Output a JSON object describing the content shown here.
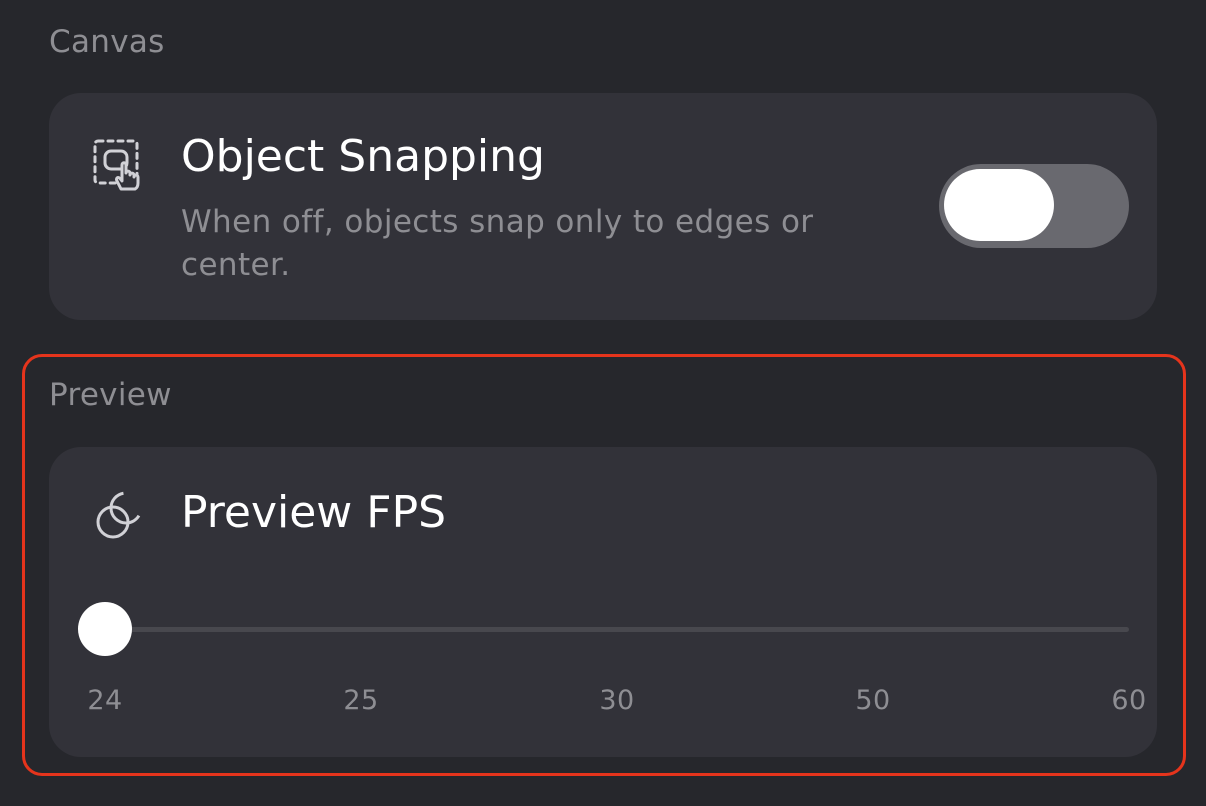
{
  "canvas_section": {
    "label": "Canvas",
    "object_snapping": {
      "icon": "object-snapping-icon",
      "title": "Object Snapping",
      "description": "When off, objects snap only to edges or center.",
      "toggle_on": false
    }
  },
  "preview_section": {
    "label": "Preview",
    "preview_fps": {
      "icon": "overlapping-circles-icon",
      "title": "Preview FPS",
      "options": [
        "24",
        "25",
        "30",
        "50",
        "60"
      ],
      "selected": "24"
    }
  },
  "colors": {
    "background": "#26272c",
    "card": "#323239",
    "highlight": "#e5341c",
    "toggle_off": "#69696f"
  }
}
